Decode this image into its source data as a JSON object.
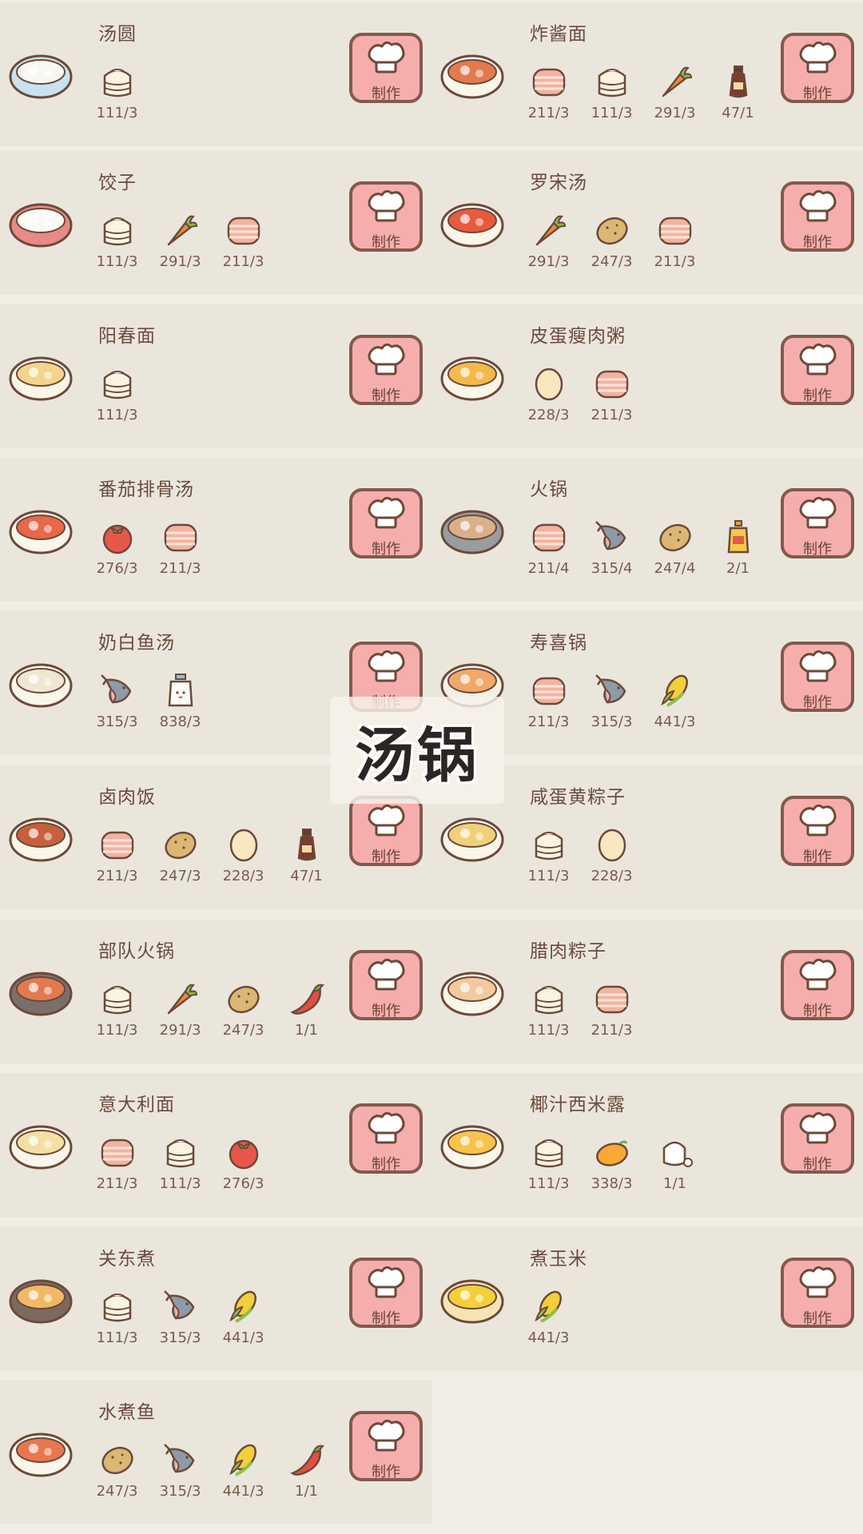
{
  "category_title": "汤锅",
  "make_label": "制作",
  "recipes": [
    {
      "name": "汤圆",
      "dish": "tangyuan-bowl-icon",
      "ingredients": [
        {
          "icon": "flour-sack-icon",
          "qty": "111/3"
        }
      ]
    },
    {
      "name": "炸酱面",
      "dish": "zhajiang-noodles-icon",
      "ingredients": [
        {
          "icon": "meat-icon",
          "qty": "211/3"
        },
        {
          "icon": "flour-sack-icon",
          "qty": "111/3"
        },
        {
          "icon": "carrot-icon",
          "qty": "291/3"
        },
        {
          "icon": "soy-sauce-icon",
          "qty": "47/1"
        }
      ]
    },
    {
      "name": "饺子",
      "dish": "dumplings-plate-icon",
      "ingredients": [
        {
          "icon": "flour-sack-icon",
          "qty": "111/3"
        },
        {
          "icon": "carrot-icon",
          "qty": "291/3"
        },
        {
          "icon": "meat-icon",
          "qty": "211/3"
        }
      ]
    },
    {
      "name": "罗宋汤",
      "dish": "borscht-bowl-icon",
      "ingredients": [
        {
          "icon": "carrot-icon",
          "qty": "291/3"
        },
        {
          "icon": "potato-icon",
          "qty": "247/3"
        },
        {
          "icon": "meat-icon",
          "qty": "211/3"
        }
      ]
    },
    {
      "name": "阳春面",
      "dish": "yangchun-noodles-icon",
      "ingredients": [
        {
          "icon": "flour-sack-icon",
          "qty": "111/3"
        }
      ]
    },
    {
      "name": "皮蛋瘦肉粥",
      "dish": "congee-bowl-icon",
      "ingredients": [
        {
          "icon": "egg-icon",
          "qty": "228/3"
        },
        {
          "icon": "meat-icon",
          "qty": "211/3"
        }
      ]
    },
    {
      "name": "番茄排骨汤",
      "dish": "tomato-rib-soup-icon",
      "ingredients": [
        {
          "icon": "tomato-icon",
          "qty": "276/3"
        },
        {
          "icon": "meat-icon",
          "qty": "211/3"
        }
      ]
    },
    {
      "name": "火锅",
      "dish": "hotpot-icon",
      "ingredients": [
        {
          "icon": "meat-icon",
          "qty": "211/4"
        },
        {
          "icon": "fish-icon",
          "qty": "315/4"
        },
        {
          "icon": "potato-icon",
          "qty": "247/4"
        },
        {
          "icon": "oil-bottle-icon",
          "qty": "2/1"
        }
      ]
    },
    {
      "name": "奶白鱼汤",
      "dish": "fish-soup-icon",
      "ingredients": [
        {
          "icon": "fish-icon",
          "qty": "315/3"
        },
        {
          "icon": "milk-icon",
          "qty": "838/3"
        }
      ]
    },
    {
      "name": "寿喜锅",
      "dish": "sukiyaki-icon",
      "ingredients": [
        {
          "icon": "meat-icon",
          "qty": "211/3"
        },
        {
          "icon": "fish-icon",
          "qty": "315/3"
        },
        {
          "icon": "corn-icon",
          "qty": "441/3"
        }
      ]
    },
    {
      "name": "卤肉饭",
      "dish": "braised-pork-rice-icon",
      "ingredients": [
        {
          "icon": "meat-icon",
          "qty": "211/3"
        },
        {
          "icon": "potato-icon",
          "qty": "247/3"
        },
        {
          "icon": "egg-icon",
          "qty": "228/3"
        },
        {
          "icon": "soy-sauce-icon",
          "qty": "47/1"
        }
      ]
    },
    {
      "name": "咸蛋黄粽子",
      "dish": "yolk-zongzi-icon",
      "ingredients": [
        {
          "icon": "flour-sack-icon",
          "qty": "111/3"
        },
        {
          "icon": "egg-icon",
          "qty": "228/3"
        }
      ]
    },
    {
      "name": "部队火锅",
      "dish": "army-stew-icon",
      "ingredients": [
        {
          "icon": "flour-sack-icon",
          "qty": "111/3"
        },
        {
          "icon": "carrot-icon",
          "qty": "291/3"
        },
        {
          "icon": "potato-icon",
          "qty": "247/3"
        },
        {
          "icon": "chili-icon",
          "qty": "1/1"
        }
      ]
    },
    {
      "name": "腊肉粽子",
      "dish": "bacon-zongzi-icon",
      "ingredients": [
        {
          "icon": "flour-sack-icon",
          "qty": "111/3"
        },
        {
          "icon": "meat-icon",
          "qty": "211/3"
        }
      ]
    },
    {
      "name": "意大利面",
      "dish": "spaghetti-icon",
      "ingredients": [
        {
          "icon": "meat-icon",
          "qty": "211/3"
        },
        {
          "icon": "flour-sack-icon",
          "qty": "111/3"
        },
        {
          "icon": "tomato-icon",
          "qty": "276/3"
        }
      ]
    },
    {
      "name": "椰汁西米露",
      "dish": "sago-dessert-icon",
      "ingredients": [
        {
          "icon": "flour-sack-icon",
          "qty": "111/3"
        },
        {
          "icon": "mango-icon",
          "qty": "338/3"
        },
        {
          "icon": "sugar-icon",
          "qty": "1/1"
        }
      ]
    },
    {
      "name": "关东煮",
      "dish": "oden-icon",
      "ingredients": [
        {
          "icon": "flour-sack-icon",
          "qty": "111/3"
        },
        {
          "icon": "fish-icon",
          "qty": "315/3"
        },
        {
          "icon": "corn-icon",
          "qty": "441/3"
        }
      ]
    },
    {
      "name": "煮玉米",
      "dish": "boiled-corn-icon",
      "ingredients": [
        {
          "icon": "corn-icon",
          "qty": "441/3"
        }
      ]
    },
    {
      "name": "水煮鱼",
      "dish": "boiled-fish-icon",
      "ingredients": [
        {
          "icon": "potato-icon",
          "qty": "247/3"
        },
        {
          "icon": "fish-icon",
          "qty": "315/3"
        },
        {
          "icon": "corn-icon",
          "qty": "441/3"
        },
        {
          "icon": "chili-icon",
          "qty": "1/1"
        }
      ]
    }
  ],
  "colors": {
    "background": "#f1ede4",
    "card": "#ebe6dc",
    "button": "#f6aeac",
    "button_border": "#825a4c",
    "text": "#6a4c3e"
  }
}
